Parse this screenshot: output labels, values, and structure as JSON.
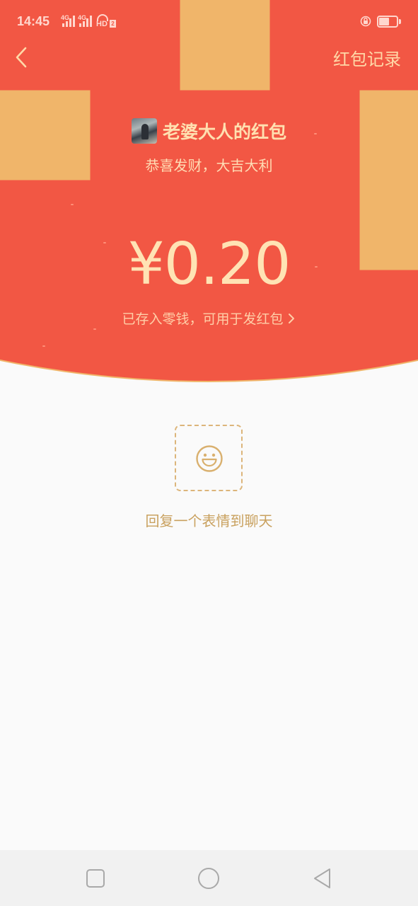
{
  "status_bar": {
    "time": "14:45",
    "signal_1": "4G",
    "signal_2": "4G",
    "hd_label": "HD",
    "hd_sub": "2"
  },
  "nav": {
    "back_icon": "chevron-left-icon",
    "records_label": "红包记录"
  },
  "packet": {
    "sender_name": "老婆大人的红包",
    "greeting": "恭喜发财，大吉大利",
    "amount": "¥0.20",
    "saved_note": "已存入零钱，可用于发红包"
  },
  "reply": {
    "label": "回复一个表情到聊天",
    "icon": "smile-icon"
  },
  "colors": {
    "header_red": "#f25744",
    "gold_text": "#ffe3b4",
    "reply_gold": "#c9a15f"
  }
}
